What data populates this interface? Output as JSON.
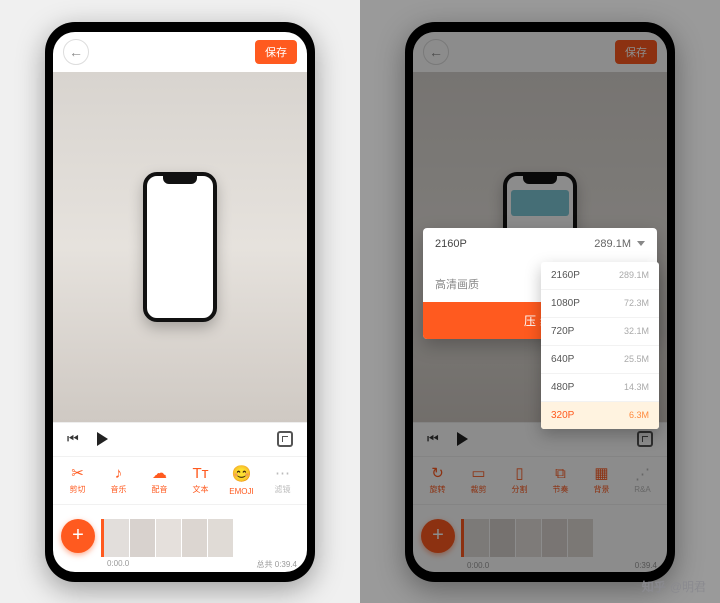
{
  "colors": {
    "accent": "#ff5a1f"
  },
  "leftPhone": {
    "saveLabel": "保存",
    "tools": [
      {
        "icon": "✂",
        "label": "剪切"
      },
      {
        "icon": "♪",
        "label": "音乐"
      },
      {
        "icon": "☁",
        "label": "配音"
      },
      {
        "icon": "Tᴛ",
        "label": "文本"
      },
      {
        "icon": "😊",
        "label": "EMOJI"
      },
      {
        "icon": "⋯",
        "label": "滤镜"
      }
    ],
    "timeline": {
      "start": "0:00.0",
      "end": "总共 0:39.4"
    }
  },
  "rightPhone": {
    "saveLabel": "保存",
    "panel": {
      "selectedRes": "2160P",
      "selectedSize": "289.1M",
      "qualityLabel": "高清画质",
      "confirmLabel": "压缩",
      "options": [
        {
          "res": "2160P",
          "size": "289.1M"
        },
        {
          "res": "1080P",
          "size": "72.3M"
        },
        {
          "res": "720P",
          "size": "32.1M"
        },
        {
          "res": "640P",
          "size": "25.5M"
        },
        {
          "res": "480P",
          "size": "14.3M"
        },
        {
          "res": "320P",
          "size": "6.3M"
        }
      ]
    },
    "tools": [
      {
        "icon": "↻",
        "label": "旋转"
      },
      {
        "icon": "▭",
        "label": "裁剪"
      },
      {
        "icon": "▯",
        "label": "分割"
      },
      {
        "icon": "⧉",
        "label": "节奏"
      },
      {
        "icon": "▦",
        "label": "背景"
      },
      {
        "icon": "⋰",
        "label": "R&A"
      }
    ],
    "timeline": {
      "start": "0:00.0",
      "end": "0:39.4"
    }
  },
  "watermark": {
    "brand": "知乎",
    "user": "@明君"
  }
}
